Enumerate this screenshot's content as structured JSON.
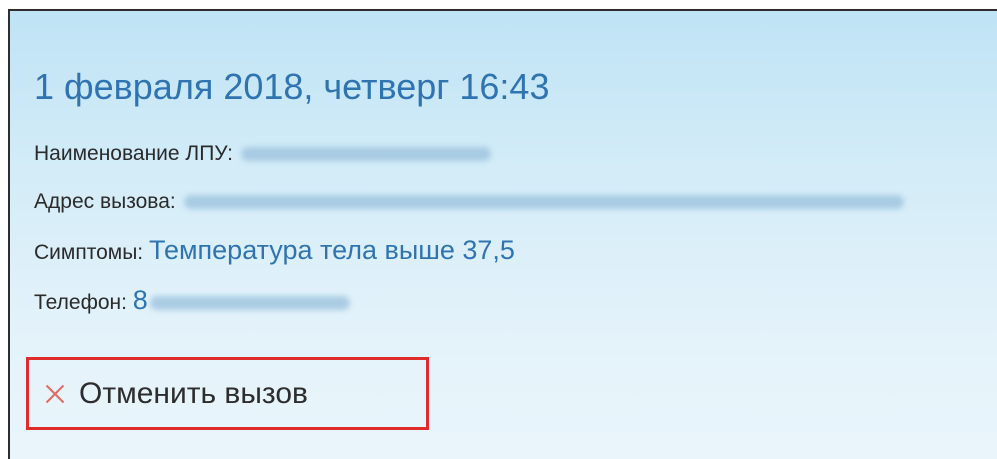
{
  "call": {
    "date_title": "1 февраля 2018, четверг 16:43",
    "lpu_label": "Наименование ЛПУ:",
    "address_label": "Адрес вызова:",
    "symptoms_label": "Симптомы:",
    "symptoms_value": "Температура тела выше 37,5",
    "phone_label": "Телефон:",
    "phone_prefix": "8"
  },
  "actions": {
    "cancel_label": "Отменить вызов"
  },
  "colors": {
    "accent_blue": "#2f74b0",
    "highlight_red": "#e02b2b",
    "cancel_icon": "#e16a62"
  }
}
